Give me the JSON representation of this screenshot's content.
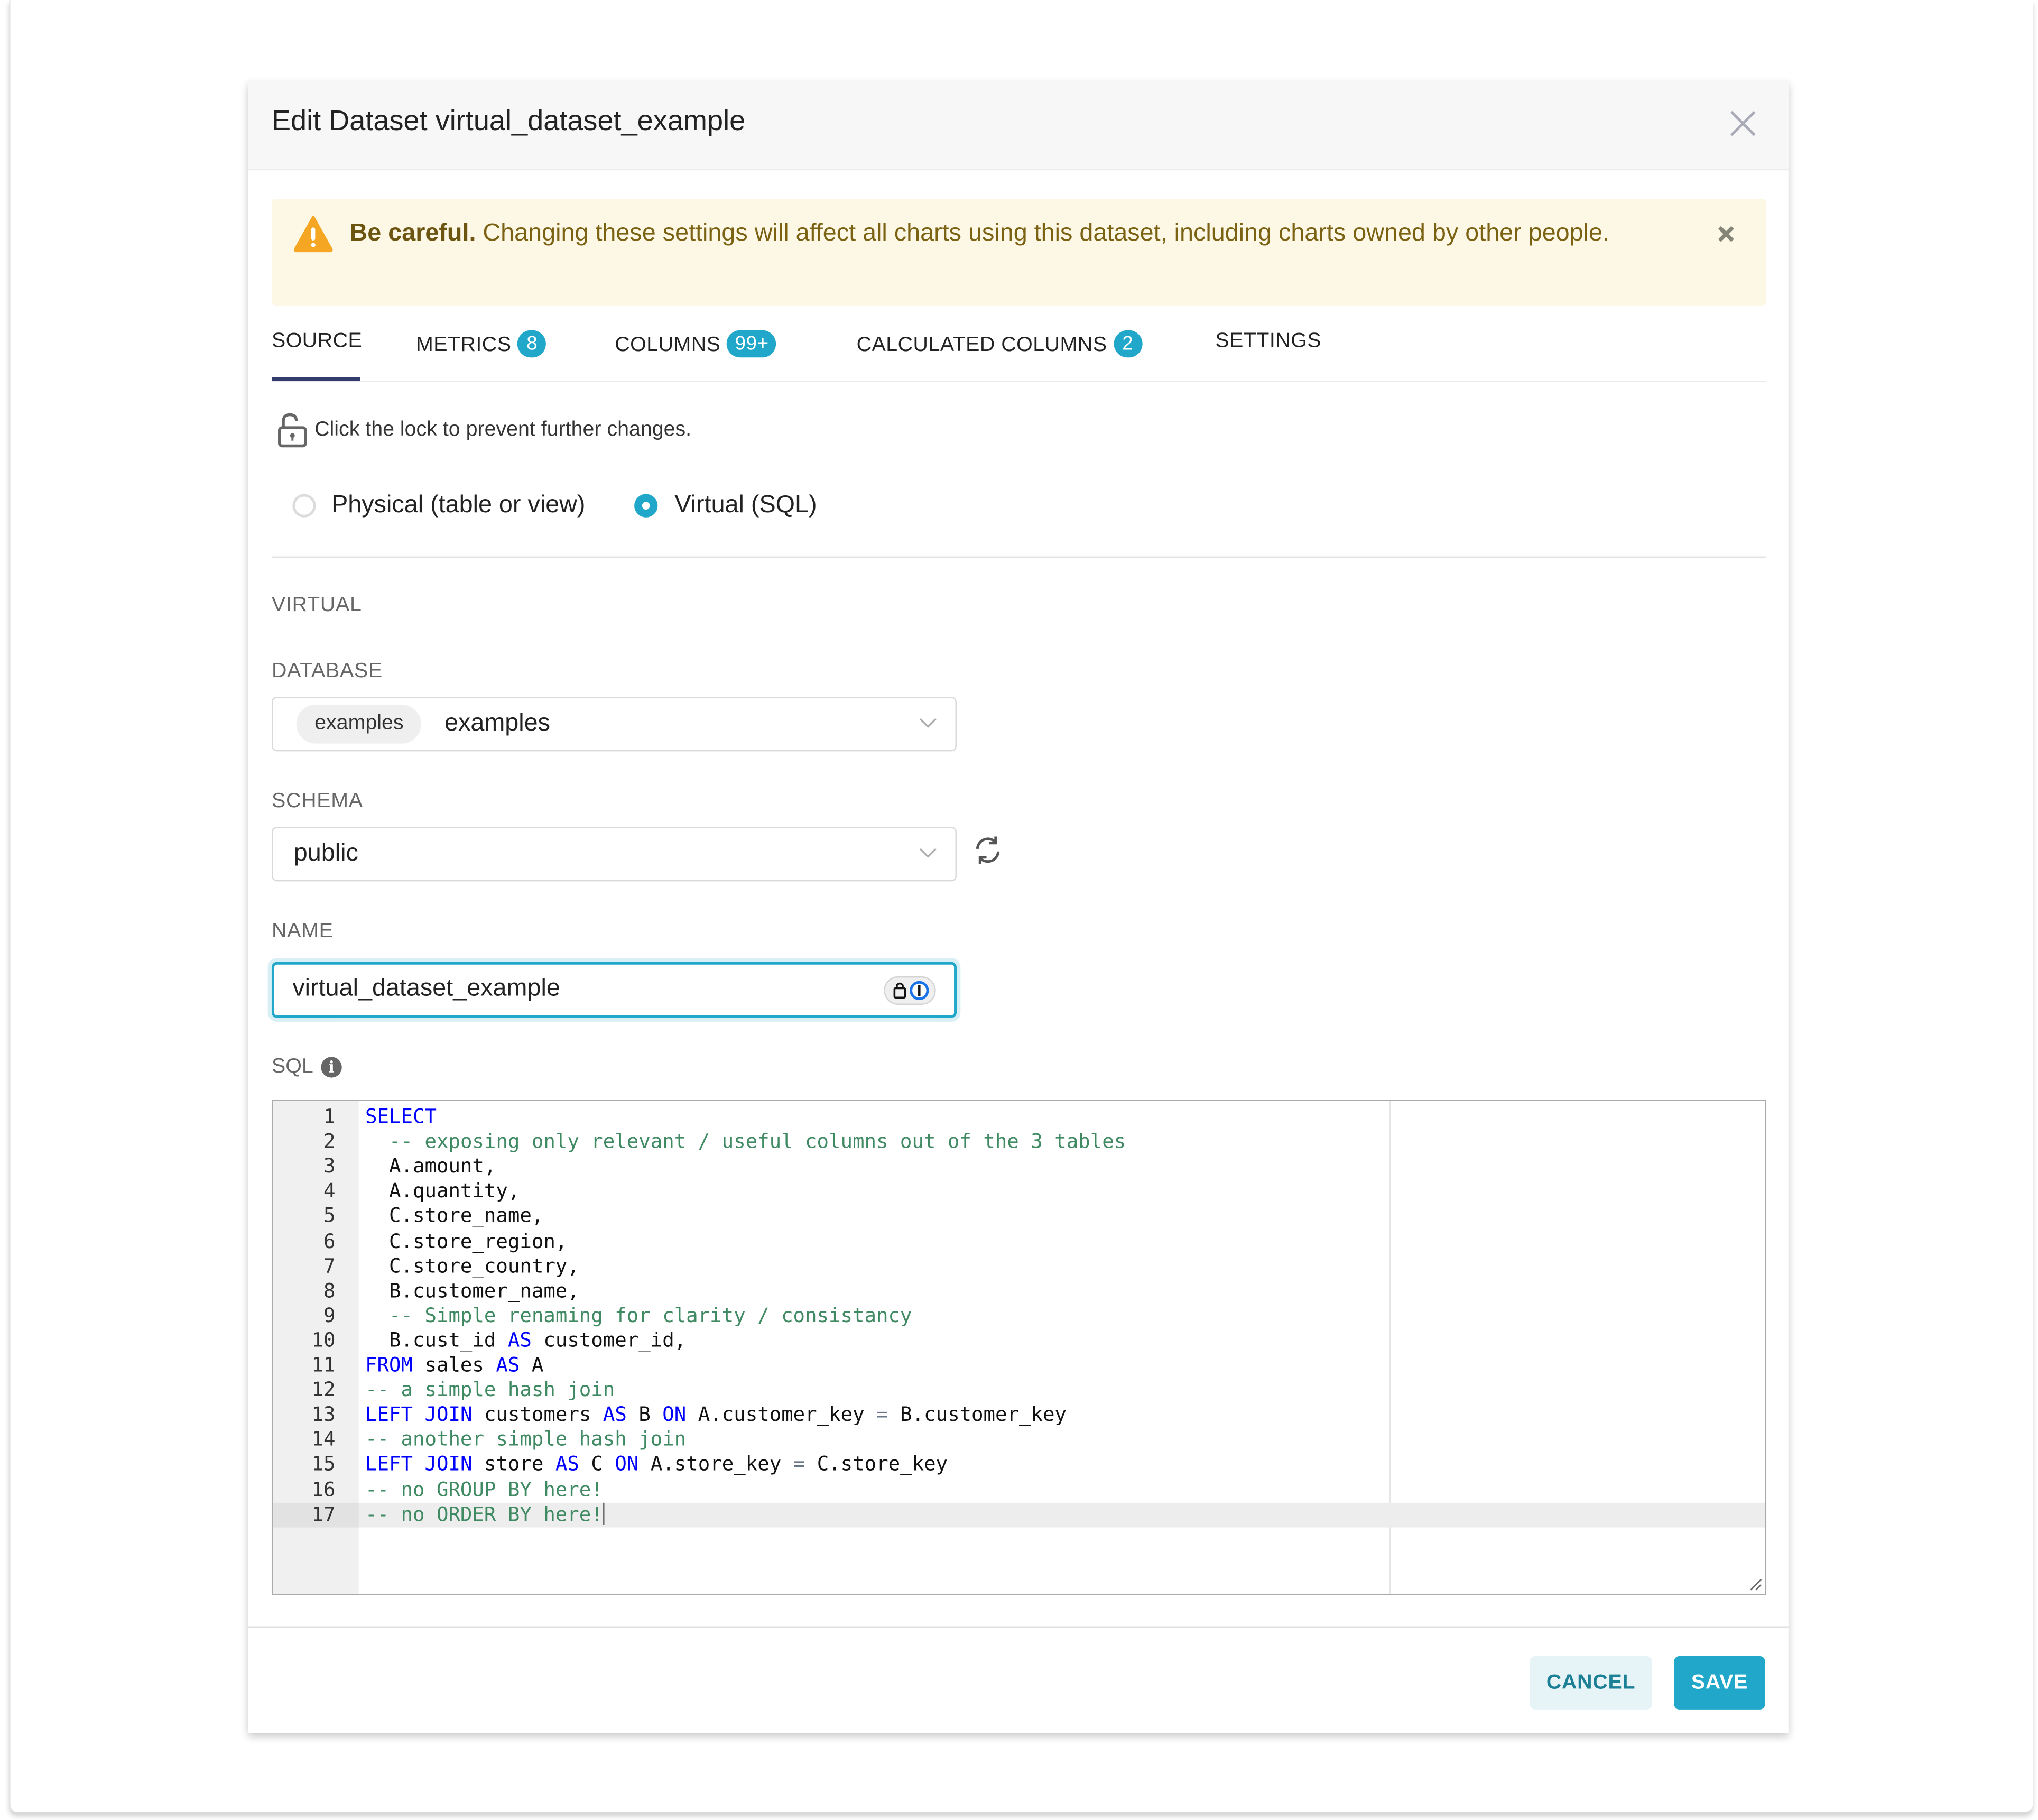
{
  "modal": {
    "title": "Edit Dataset virtual_dataset_example"
  },
  "alert": {
    "bold": "Be careful.",
    "text": " Changing these settings will affect all charts using this dataset, including charts owned by other people."
  },
  "tabs": [
    {
      "label": "SOURCE",
      "badge": null,
      "active": true
    },
    {
      "label": "METRICS",
      "badge": "8"
    },
    {
      "label": "COLUMNS",
      "badge": "99+"
    },
    {
      "label": "CALCULATED COLUMNS",
      "badge": "2"
    },
    {
      "label": "SETTINGS",
      "badge": null
    }
  ],
  "lock_hint": "Click the lock to prevent further changes.",
  "source_type": {
    "options": [
      "Physical (table or view)",
      "Virtual (SQL)"
    ],
    "selected": "Virtual (SQL)"
  },
  "section_title": "VIRTUAL",
  "database": {
    "label": "DATABASE",
    "tag": "examples",
    "value": "examples"
  },
  "schema": {
    "label": "SCHEMA",
    "value": "public"
  },
  "name": {
    "label": "NAME",
    "value": "virtual_dataset_example"
  },
  "sql": {
    "label": "SQL",
    "active_line": 17,
    "lines": [
      "SELECT",
      "  -- exposing only relevant / useful columns out of the 3 tables",
      "  A.amount,",
      "  A.quantity,",
      "  C.store_name,",
      "  C.store_region,",
      "  C.store_country,",
      "  B.customer_name,",
      "  -- Simple renaming for clarity / consistancy",
      "  B.cust_id AS customer_id,",
      "FROM sales AS A",
      "-- a simple hash join",
      "LEFT JOIN customers AS B ON A.customer_key = B.customer_key",
      "-- another simple hash join",
      "LEFT JOIN store AS C ON A.store_key = C.store_key",
      "-- no GROUP BY here!",
      "-- no ORDER BY here!"
    ]
  },
  "footer": {
    "cancel_label": "CANCEL",
    "save_label": "SAVE"
  },
  "colors": {
    "accent": "#20a7c9",
    "tab_indicator": "#323d6e",
    "warning_bg": "#fdf7e6",
    "warning_text": "#7a6212",
    "warning_icon": "#f5a623",
    "sql_keyword": "#0000ff",
    "sql_comment": "#3f8a63"
  }
}
